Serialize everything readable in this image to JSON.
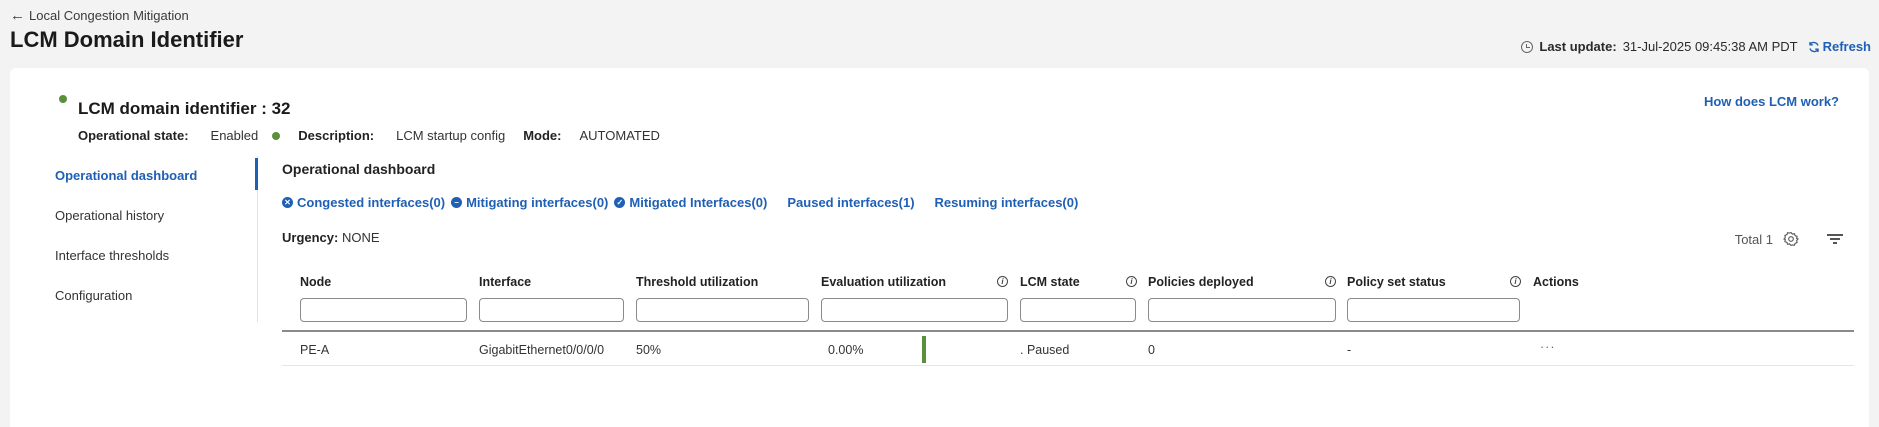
{
  "header": {
    "back_label": "Local Congestion Mitigation",
    "title": "LCM Domain Identifier",
    "last_update_label": "Last update:",
    "last_update_value": "31-Jul-2025 09:45:38 AM PDT",
    "refresh_label": "Refresh"
  },
  "domain": {
    "title": "LCM domain identifier : 32",
    "how_link": "How does LCM work?",
    "op_state_label": "Operational state:",
    "op_state_value": "Enabled",
    "description_label": "Description:",
    "description_value": "LCM startup config",
    "mode_label": "Mode:",
    "mode_value": "AUTOMATED",
    "status_color": "#5a8f3c"
  },
  "sidebar": {
    "items": [
      {
        "label": "Operational dashboard"
      },
      {
        "label": "Operational history"
      },
      {
        "label": "Interface thresholds"
      },
      {
        "label": "Configuration"
      }
    ]
  },
  "dashboard": {
    "title": "Operational dashboard",
    "filters": [
      {
        "label": "Congested interfaces(0)"
      },
      {
        "label": "Mitigating interfaces(0)"
      },
      {
        "label": "Mitigated Interfaces(0)"
      },
      {
        "label": "Paused interfaces(1)"
      },
      {
        "label": "Resuming interfaces(0)"
      }
    ],
    "urgency_label": "Urgency:",
    "urgency_value": "NONE",
    "total": "Total 1"
  },
  "table": {
    "columns": [
      "Node",
      "Interface",
      "Threshold utilization",
      "Evaluation utilization",
      "LCM state",
      "Policies deployed",
      "Policy set status",
      "Actions"
    ],
    "rows": [
      {
        "node": "PE-A",
        "interface": "GigabitEthernet0/0/0/0",
        "threshold": "50%",
        "evaluation": "0.00%",
        "lcm_state": ". Paused",
        "policies": "0",
        "policy_status": "-",
        "actions": "···"
      }
    ]
  },
  "colors": {
    "accent": "#1f5fb5",
    "status_green": "#5a8f3c"
  }
}
